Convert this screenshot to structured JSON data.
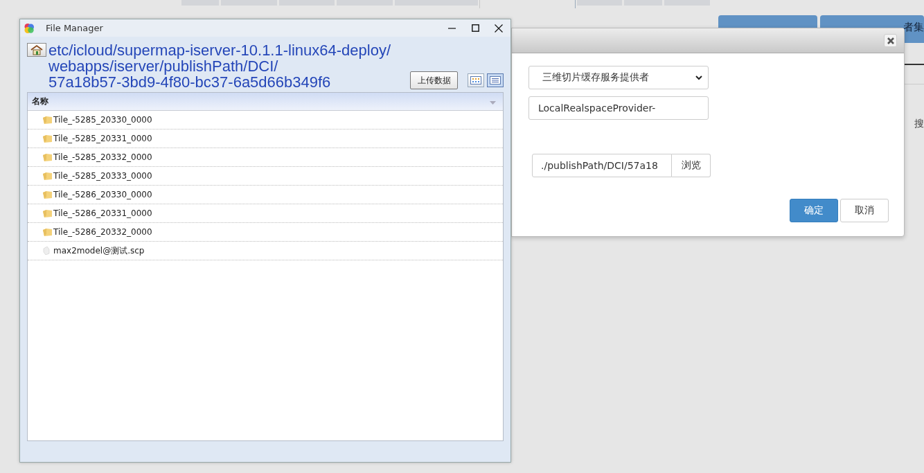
{
  "background": {
    "button_label": "者集",
    "side_text": "搜"
  },
  "file_manager": {
    "title": "File Manager",
    "path": "etc/icloud/supermap-iserver-10.1.1-linux64-deploy/webapps/iserver/publishPath/DCI/57a18b57-3bd9-4f80-bc37-6a5d66b349f6",
    "upload_button": "上传数据",
    "view_buttons": [
      {
        "kind": "icons",
        "selected": false
      },
      {
        "kind": "details",
        "selected": true
      }
    ],
    "column": "名称",
    "files": [
      {
        "name": "Tile_-5285_20330_0000",
        "kind": "folder"
      },
      {
        "name": "Tile_-5285_20331_0000",
        "kind": "folder"
      },
      {
        "name": "Tile_-5285_20332_0000",
        "kind": "folder"
      },
      {
        "name": "Tile_-5285_20333_0000",
        "kind": "folder"
      },
      {
        "name": "Tile_-5286_20330_0000",
        "kind": "folder"
      },
      {
        "name": "Tile_-5286_20331_0000",
        "kind": "folder"
      },
      {
        "name": "Tile_-5286_20332_0000",
        "kind": "folder"
      },
      {
        "name": "max2model@测试.scp",
        "kind": "file"
      }
    ]
  },
  "dialog": {
    "provider_type": "三维切片缓存服务提供者",
    "provider_name": "LocalRealspaceProvider-",
    "path": "./publishPath/DCI/57a18",
    "browse_button": "浏览",
    "ok_button": "确定",
    "cancel_button": "取消"
  }
}
